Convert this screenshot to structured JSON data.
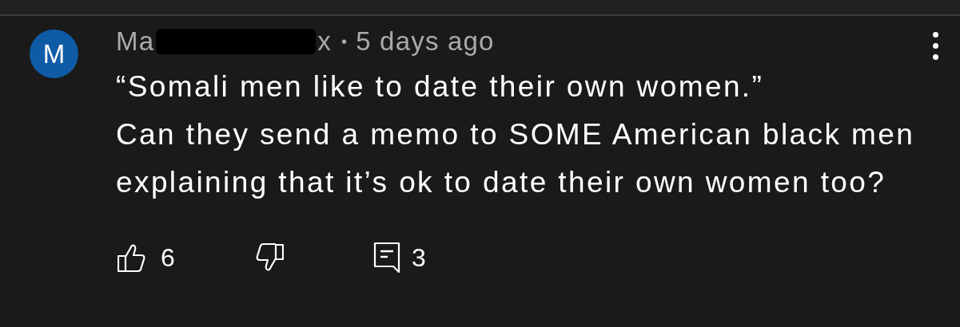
{
  "comment": {
    "avatar_letter": "M",
    "author_start": "Ma",
    "author_end": "x",
    "author_redacted": true,
    "separator": "•",
    "time": "5 days ago",
    "paragraphs": [
      "“Somali men like to date their own women.”",
      "Can they send a memo to SOME American black men explaining that it’s ok to date their own women too?"
    ],
    "likes": "6",
    "replies": "3"
  }
}
